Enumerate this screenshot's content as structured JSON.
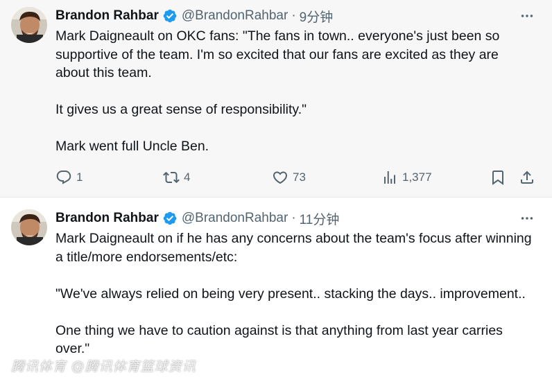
{
  "tweets": [
    {
      "display_name": "Brandon Rahbar",
      "handle": "@BrandonRahbar",
      "separator": "·",
      "time": "9分钟",
      "paragraphs": [
        "Mark Daigneault on OKC fans: \"The fans in town.. everyone's just been so supportive of the team. I'm so excited that our fans are excited as they are about this team.",
        "It gives us a great sense of responsibility.\"",
        "Mark went full Uncle Ben."
      ],
      "actions": {
        "replies": "1",
        "reposts": "4",
        "likes": "73",
        "views": "1,377"
      }
    },
    {
      "display_name": "Brandon Rahbar",
      "handle": "@BrandonRahbar",
      "separator": "·",
      "time": "11分钟",
      "paragraphs": [
        "Mark Daigneault on if he has any concerns about the team's focus after winning a title/more endorsements/etc:",
        "\"We've always relied on being very present.. stacking the days.. improvement..",
        "One thing we have to caution against is that anything from last year carries over.\""
      ]
    }
  ],
  "watermark": "腾讯体育 @腾讯体育篮球资讯",
  "colors": {
    "verified_badge": "#1d9bf0",
    "secondary_text": "#536471",
    "primary_text": "#0f1419",
    "highlighted_background": "#f7f7f7"
  },
  "icons": [
    "more-icon",
    "verified-badge-icon",
    "reply-icon",
    "repost-icon",
    "like-icon",
    "views-icon",
    "bookmark-icon",
    "share-icon"
  ]
}
